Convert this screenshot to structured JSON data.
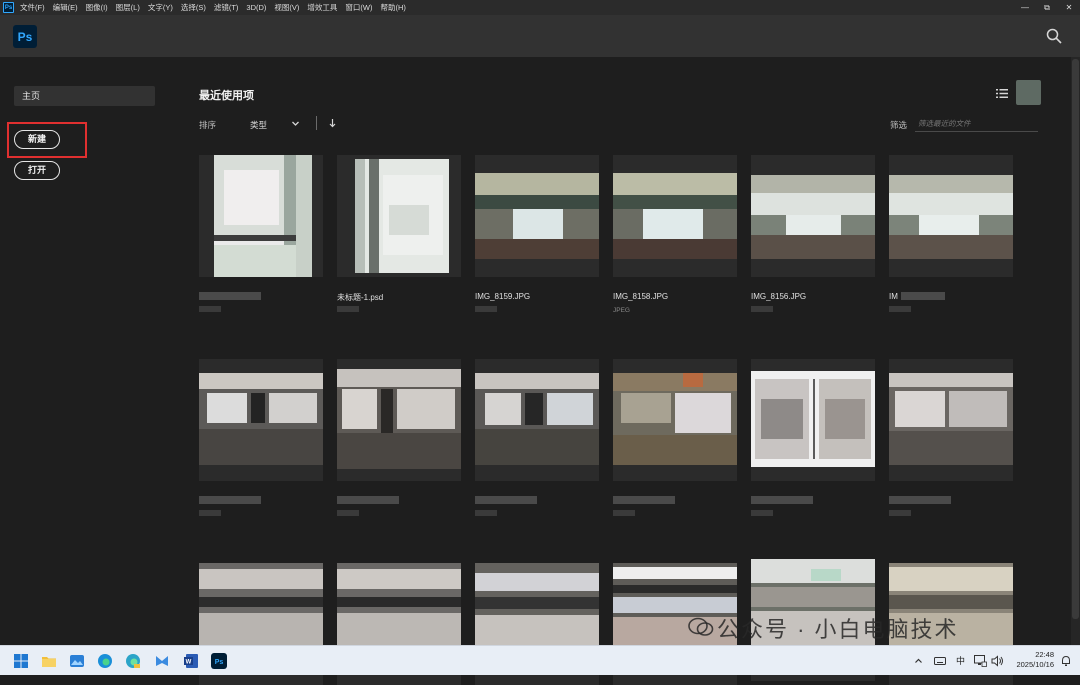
{
  "menubar": {
    "app_badge": "Ps",
    "items": [
      "文件(F)",
      "编辑(E)",
      "图像(I)",
      "图层(L)",
      "文字(Y)",
      "选择(S)",
      "滤镜(T)",
      "3D(D)",
      "视图(V)",
      "增效工具",
      "窗口(W)",
      "帮助(H)"
    ],
    "window_controls": [
      "—",
      "⧉",
      "✕"
    ]
  },
  "header": {
    "logo": "Ps"
  },
  "sidebar": {
    "home_label": "主页",
    "new_label": "新建",
    "open_label": "打开"
  },
  "main": {
    "title": "最近使用项",
    "sort_label": "排序",
    "sort_value": "类型",
    "filter_label": "筛选",
    "filter_placeholder": "筛选最近的文件"
  },
  "files": [
    {
      "name": "",
      "type": ""
    },
    {
      "name": "未标题-1.psd",
      "type": ""
    },
    {
      "name": "IMG_8159.JPG",
      "type": ""
    },
    {
      "name": "IMG_8158.JPG",
      "type": "JPEG"
    },
    {
      "name": "IMG_8156.JPG",
      "type": ""
    },
    {
      "name": "IM",
      "type": ""
    }
  ],
  "watermark": {
    "text": "公众号 · 小白电脑技术"
  },
  "taskbar": {
    "tray_ime": "中",
    "time": "22:48",
    "date": "2025/10/16"
  },
  "colors": {
    "accent_ps": "#31a8ff",
    "highlight_box": "#e03030",
    "background": "#1e1e1e",
    "taskbar": "#e8eef6"
  }
}
